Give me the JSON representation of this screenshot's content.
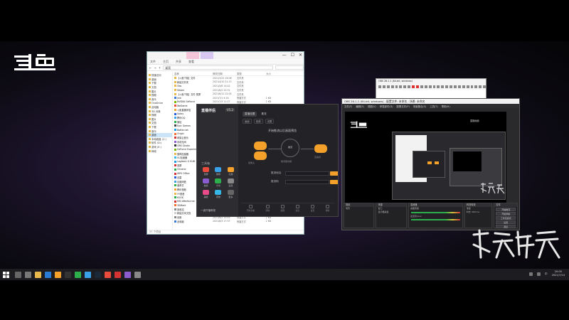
{
  "brand": {
    "logo_text": "斗鱼",
    "logo_color": "#ffffff",
    "calligraphy_text": "永劫无间"
  },
  "explorer": {
    "title_tabs": [
      "",
      ""
    ],
    "window_controls": [
      "—",
      "☐",
      "✕"
    ],
    "ribbon": [
      "文件",
      "主页",
      "共享",
      "查看"
    ],
    "address": "桌面",
    "nav": [
      {
        "label": "快速访问"
      },
      {
        "label": "桌面"
      },
      {
        "label": "下载"
      },
      {
        "label": "文档"
      },
      {
        "label": "图片"
      },
      {
        "label": "视频"
      },
      {
        "label": "音乐"
      },
      {
        "label": "OneDrive"
      },
      {
        "label": "此电脑"
      },
      {
        "label": "3D 对象"
      },
      {
        "label": "视频"
      },
      {
        "label": "图片"
      },
      {
        "label": "文档"
      },
      {
        "label": "下载"
      },
      {
        "label": "音乐"
      },
      {
        "label": "桌面"
      },
      {
        "label": "本地磁盘 (C:)"
      },
      {
        "label": "软件 (D:)"
      },
      {
        "label": "游戏 (E:)"
      },
      {
        "label": "网络"
      }
    ],
    "columns": [
      "名称",
      "修改日期",
      "类型",
      "大小"
    ],
    "files": [
      {
        "name": "【斗鱼下载】文件",
        "date": "2021/3/22 19:06",
        "type": "文件夹",
        "size": "",
        "c": "#e8b94a"
      },
      {
        "name": "新建文件夹",
        "date": "2021/4/10 21:13",
        "type": "文件夹",
        "size": "",
        "c": "#e8b94a"
      },
      {
        "name": "Obs",
        "date": "2021/5/8 14:42",
        "type": "文件夹",
        "size": "",
        "c": "#e8b94a"
      },
      {
        "name": "Steam",
        "date": "2021/6/2 20:31",
        "type": "文件夹",
        "size": "",
        "c": "#e8b94a"
      },
      {
        "name": "【斗鱼下载】文件 录屏",
        "date": "2021/6/12 22:05",
        "type": "文件夹",
        "size": "",
        "c": "#e8b94a"
      },
      {
        "name": "jmk",
        "date": "2021/7/1 9:18",
        "type": "快捷方式",
        "size": "2 KB",
        "c": "#3a7bd5"
      },
      {
        "name": "NVIDIA GeForce",
        "date": "2021/7/3 11:27",
        "type": "快捷方式",
        "size": "2 KB",
        "c": "#76b900"
      },
      {
        "name": "WeGame",
        "date": "2021/7/5 18:40",
        "type": "快捷方式",
        "size": "2 KB",
        "c": "#e94b3c"
      },
      {
        "name": "斗鱼直播伴侣",
        "date": "2021/7/6 20:12",
        "type": "快捷方式",
        "size": "2 KB",
        "c": "#f3a12a"
      },
      {
        "name": "Uplay",
        "date": "2021/7/7 8:55",
        "type": "快捷方式",
        "size": "2 KB",
        "c": "#2a5bd7"
      },
      {
        "name": "腾讯QQ",
        "date": "2021/7/8 13:30",
        "type": "快捷方式",
        "size": "2 KB",
        "c": "#3aa0e8"
      },
      {
        "name": "微信",
        "date": "2021/7/9 16:02",
        "type": "快捷方式",
        "size": "2 KB",
        "c": "#2db04b"
      },
      {
        "name": "Epic Games",
        "date": "2021/7/10 19:20",
        "type": "快捷方式",
        "size": "2 KB",
        "c": "#444444"
      },
      {
        "name": "Battle.net",
        "date": "2021/7/11 21:48",
        "type": "快捷方式",
        "size": "2 KB",
        "c": "#1ea0e6"
      },
      {
        "name": "Origin",
        "date": "2021/7/12 10:01",
        "type": "快捷方式",
        "size": "2 KB",
        "c": "#f56c2d"
      },
      {
        "name": "网易云音乐",
        "date": "2021/7/13 12:44",
        "type": "快捷方式",
        "size": "2 KB",
        "c": "#d33333"
      },
      {
        "name": "永劫无间",
        "date": "2021/7/14 22:10",
        "type": "快捷方式",
        "size": "2 KB",
        "c": "#8a5cd0"
      },
      {
        "name": "OBS Studio",
        "date": "2021/7/15 9:33",
        "type": "快捷方式",
        "size": "2 KB",
        "c": "#333333"
      },
      {
        "name": "GeForce Experience",
        "date": "2021/7/16 15:26",
        "type": "快捷方式",
        "size": "2 KB",
        "c": "#76b900"
      },
      {
        "name": "雷神加速器",
        "date": "2021/7/17 17:09",
        "type": "快捷方式",
        "size": "2 KB",
        "c": "#e8b94a"
      },
      {
        "name": "UU加速器",
        "date": "2021/7/18 11:51",
        "type": "快捷方式",
        "size": "2 KB",
        "c": "#35b7e8"
      },
      {
        "name": "Logitech G HUB",
        "date": "2021/7/19 20:37",
        "type": "快捷方式",
        "size": "2 KB",
        "c": "#1ea0e6"
      },
      {
        "name": "录屏",
        "date": "2021/7/20 14:18",
        "type": "快捷方式",
        "size": "2 KB",
        "c": "#d33333"
      },
      {
        "name": "Chrome",
        "date": "2021/7/21 8:47",
        "type": "快捷方式",
        "size": "2 KB",
        "c": "#2db04b"
      },
      {
        "name": "WPS Office",
        "date": "2021/7/22 19:02",
        "type": "快捷方式",
        "size": "2 KB",
        "c": "#d33333"
      },
      {
        "name": "迅雷",
        "date": "2021/7/23 21:55",
        "type": "快捷方式",
        "size": "2 KB",
        "c": "#2a5bd7"
      },
      {
        "name": "百度网盘",
        "date": "2021/7/24 10:40",
        "type": "快捷方式",
        "size": "2 KB",
        "c": "#3aa0e8"
      },
      {
        "name": "爱奇艺",
        "date": "2021/7/25 13:13",
        "type": "快捷方式",
        "size": "2 KB",
        "c": "#2db04b"
      },
      {
        "name": "腾讯视频",
        "date": "2021/7/26 16:28",
        "type": "快捷方式",
        "size": "2 KB",
        "c": "#f3a12a"
      },
      {
        "name": "YY语音",
        "date": "2021/7/27 18:06",
        "type": "快捷方式",
        "size": "2 KB",
        "c": "#e8b94a"
      },
      {
        "name": "KOOK",
        "date": "2021/7/28 20:50",
        "type": "快捷方式",
        "size": "2 KB",
        "c": "#2db04b"
      },
      {
        "name": "MSI Afterburner",
        "date": "2021/7/29 22:31",
        "type": "快捷方式",
        "size": "2 KB",
        "c": "#d33333"
      },
      {
        "name": "3DMark",
        "date": "2021/7/30 9:04",
        "type": "快捷方式",
        "size": "2 KB",
        "c": "#f56c2d"
      },
      {
        "name": "回收站",
        "date": "2021/7/31 11:22",
        "type": "快捷方式",
        "size": "2 KB",
        "c": "#888888"
      },
      {
        "name": "新建文本文档",
        "date": "2021/8/1 12:12",
        "type": "文本文档",
        "size": "1 KB",
        "c": "#cccccc"
      },
      {
        "name": "设置",
        "date": "2021/8/2 15:45",
        "type": "快捷方式",
        "size": "2 KB",
        "c": "#888888"
      },
      {
        "name": "此电脑",
        "date": "2021/8/3 17:37",
        "type": "快捷方式",
        "size": "2 KB",
        "c": "#3a7bd5"
      }
    ],
    "status": "37 个项目"
  },
  "streamer": {
    "app_name": "直播伴侣",
    "version": "V5.2",
    "tabs": [
      {
        "label": "直播设置",
        "active": true
      },
      {
        "label": "推流",
        "active": false
      }
    ],
    "subtabs": [
      "画面",
      "音频",
      "设置"
    ],
    "flow_title": "开始推流以后画面预览",
    "circle_label": "推流",
    "node_labels": [
      "摄像头",
      "推流服务器",
      "直播间"
    ],
    "side_title": "工具箱",
    "tools": [
      {
        "label": "录屏",
        "color": "#e94b3c"
      },
      {
        "label": "弹幕",
        "color": "#3aa0e8"
      },
      {
        "label": "礼物",
        "color": "#f3a12a"
      },
      {
        "label": "抽奖",
        "color": "#8a5cd0"
      },
      {
        "label": "分享",
        "color": "#2db04b"
      },
      {
        "label": "设置",
        "color": "#888888"
      },
      {
        "label": "美颜",
        "color": "#e94b8a"
      },
      {
        "label": "音效",
        "color": "#35b7e8"
      },
      {
        "label": "更多",
        "color": "#666666"
      }
    ],
    "fields": [
      {
        "label": "推流地址"
      },
      {
        "label": "推流码"
      }
    ],
    "bottom_link": "一键开播教程",
    "footer": [
      "开始直播",
      "录制",
      "截图",
      "连麦",
      "设置",
      "帮助"
    ],
    "accent": "#f3a12a"
  },
  "obs": {
    "title": "OBS 26.1.1 (64-bit, windows) - 配置文件: 未命名 - 场景: 未命名",
    "menu": [
      "文件(F)",
      "编辑(E)",
      "视图(V)",
      "停靠部件(D)",
      "配置文件(P)",
      "场景集合(S)",
      "工具(T)",
      "帮助(H)"
    ],
    "preview_logo": "斗鱼",
    "preview_caption": "直播画面",
    "docks": [
      {
        "title": "场景",
        "rows": [
          "场景"
        ]
      },
      {
        "title": "来源",
        "rows": [
          "窗口",
          "显示器采集"
        ]
      },
      {
        "title": "混音器",
        "rows": [
          "桌面音频",
          "麦克风/Aux"
        ]
      },
      {
        "title": "转场特效",
        "rows": [
          "渐变",
          "时长 300 ms"
        ]
      },
      {
        "title": "控件",
        "rows": [
          "开始推流",
          "开始录制",
          "工作室模式",
          "设置",
          "退出"
        ]
      }
    ]
  },
  "mini": {
    "title": "OBS 26.1.1 (64-bit, windows)",
    "tools_count": 26
  },
  "taskbar": {
    "apps": [
      {
        "name": "search",
        "color": "#666666"
      },
      {
        "name": "task-view",
        "color": "#777777"
      },
      {
        "name": "explorer",
        "color": "#e8b94a"
      },
      {
        "name": "edge",
        "color": "#2a7bd5"
      },
      {
        "name": "streamer",
        "color": "#f3a12a"
      },
      {
        "name": "obs",
        "color": "#333333"
      },
      {
        "name": "wechat",
        "color": "#2db04b"
      },
      {
        "name": "qq",
        "color": "#3aa0e8"
      },
      {
        "name": "steam",
        "color": "#1b2838"
      },
      {
        "name": "wegame",
        "color": "#e94b3c"
      },
      {
        "name": "netease",
        "color": "#d33333"
      },
      {
        "name": "naraka",
        "color": "#8a5cd0"
      },
      {
        "name": "settings",
        "color": "#888888"
      }
    ],
    "lang": "中",
    "clock_time": "20:00",
    "clock_date": "2021/7/14"
  }
}
